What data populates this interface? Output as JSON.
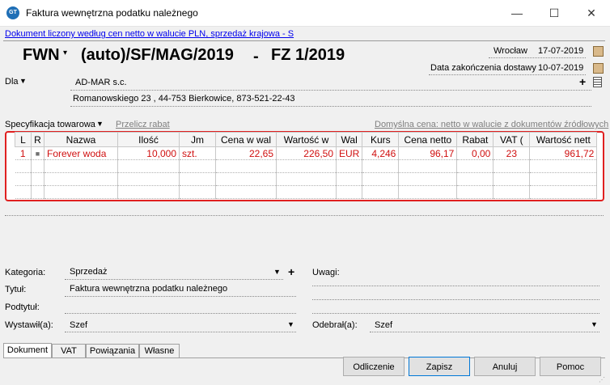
{
  "window": {
    "title": "Faktura wewnętrzna podatku należnego",
    "minimize": "—",
    "maximize": "☐",
    "close": "✕"
  },
  "mode_link": "Dokument liczony według cen netto w walucie PLN, sprzedaż krajowa - S",
  "document": {
    "symbol": "FWN",
    "number": "(auto)/SF/MAG/2019",
    "dash": "-",
    "related": "FZ 1/2019"
  },
  "place_date": {
    "place": "Wrocław",
    "date": "17-07-2019"
  },
  "delivery": {
    "label": "Data zakończenia dostawy",
    "date": "10-07-2019"
  },
  "recipient": {
    "label": "Dla",
    "name": "AD-MAR s.c.",
    "address": "Romanowskiego 23 , 44-753 Bierkowice, 873-521-22-43",
    "add_icon": "+"
  },
  "spec": {
    "label": "Specyfikacja towarowa",
    "recalc_link": "Przelicz rabat",
    "default_price": "Domyślna cena: netto w walucie z dokumentów źródłowych"
  },
  "grid": {
    "columns": [
      "L",
      "R",
      "Nazwa",
      "Ilość",
      "Jm",
      "Cena w wal",
      "Wartość w",
      "Wal",
      "Kurs",
      "Cena netto",
      "Rabat",
      "VAT (",
      "Wartość nett"
    ],
    "rows": [
      {
        "l": "1",
        "r": "■",
        "name": "Forever woda",
        "qty": "10,000",
        "unit": "szt.",
        "price_cur": "22,65",
        "value_cur": "226,50",
        "cur": "EUR",
        "rate": "4,246",
        "net_price": "96,17",
        "discount": "0,00",
        "vat": "23",
        "net_value": "961,72"
      }
    ]
  },
  "fields": {
    "category_label": "Kategoria:",
    "category_value": "Sprzedaż",
    "title_label": "Tytuł:",
    "title_value": "Faktura wewnętrzna podatku należnego",
    "subtitle_label": "Podtytuł:",
    "issued_label": "Wystawił(a):",
    "issued_value": "Szef",
    "notes_label": "Uwagi:",
    "received_label": "Odebrał(a):",
    "received_value": "Szef"
  },
  "tabs": [
    "Dokument",
    "VAT",
    "Powiązania",
    "Własne"
  ],
  "buttons": {
    "odliczenie": "Odliczenie",
    "zapisz": "Zapisz",
    "anuluj": "Anuluj",
    "pomoc": "Pomoc"
  },
  "colors": {
    "highlight_border": "#e02020",
    "row_text": "#d01010",
    "link": "#0000ee"
  },
  "icons": [
    "app-icon",
    "calendar-icon",
    "plus-icon",
    "list-icon",
    "dropdown-caret-icon"
  ]
}
